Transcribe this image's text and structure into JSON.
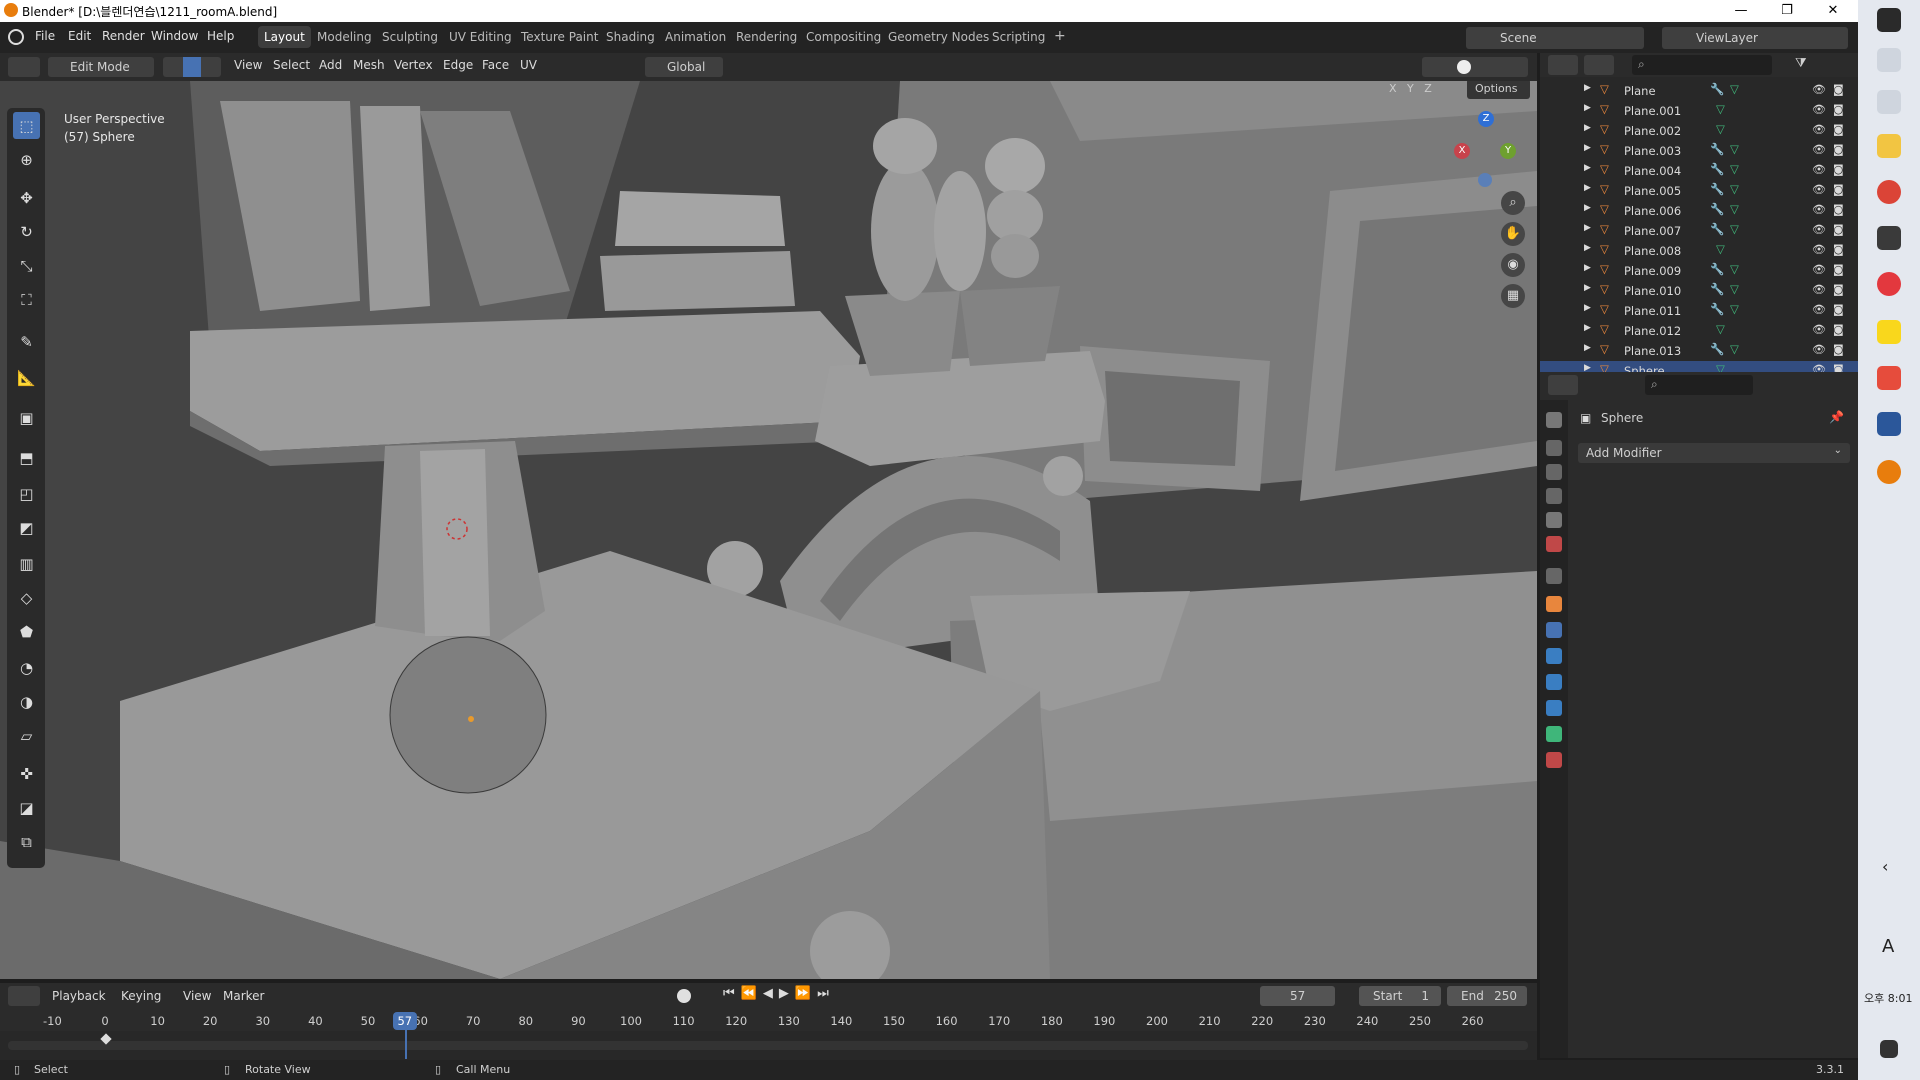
{
  "window": {
    "title": "Blender* [D:\\블렌더연습\\1211_roomA.blend]",
    "minimize": "—",
    "maximize": "❐",
    "close": "✕"
  },
  "menu": {
    "items": [
      "File",
      "Edit",
      "Render",
      "Window",
      "Help"
    ]
  },
  "workspaces": [
    "Layout",
    "Modeling",
    "Sculpting",
    "UV Editing",
    "Texture Paint",
    "Shading",
    "Animation",
    "Rendering",
    "Compositing",
    "Geometry Nodes",
    "Scripting",
    "+"
  ],
  "scene": {
    "name": "Scene",
    "view_layer": "ViewLayer"
  },
  "viewport_header": {
    "mode": "Edit Mode",
    "menus": [
      "View",
      "Select",
      "Add",
      "Mesh",
      "Vertex",
      "Edge",
      "Face",
      "UV"
    ],
    "transform": "Global",
    "options": "Options",
    "axes": [
      "X",
      "Y",
      "Z"
    ]
  },
  "viewport": {
    "perspective": "User Perspective",
    "object": "(57) Sphere"
  },
  "gizmo": {
    "z": "Z",
    "x": "X",
    "y": "Y"
  },
  "outliner": {
    "rows": [
      {
        "name": "Plane",
        "modifier": true
      },
      {
        "name": "Plane.001",
        "modifier": false
      },
      {
        "name": "Plane.002",
        "modifier": false
      },
      {
        "name": "Plane.003",
        "modifier": true
      },
      {
        "name": "Plane.004",
        "modifier": true
      },
      {
        "name": "Plane.005",
        "modifier": true
      },
      {
        "name": "Plane.006",
        "modifier": true
      },
      {
        "name": "Plane.007",
        "modifier": true
      },
      {
        "name": "Plane.008",
        "modifier": false
      },
      {
        "name": "Plane.009",
        "modifier": true
      },
      {
        "name": "Plane.010",
        "modifier": true
      },
      {
        "name": "Plane.011",
        "modifier": true
      },
      {
        "name": "Plane.012",
        "modifier": false
      },
      {
        "name": "Plane.013",
        "modifier": true
      },
      {
        "name": "Sphere",
        "modifier": false
      }
    ]
  },
  "properties": {
    "object": "Sphere",
    "add_modifier": "Add Modifier"
  },
  "timeline": {
    "menus": [
      "Playback",
      "Keying",
      "View",
      "Marker"
    ],
    "current_frame": "57",
    "start_label": "Start",
    "start": "1",
    "end_label": "End",
    "end": "250",
    "ticks": [
      "-10",
      "0",
      "10",
      "20",
      "30",
      "40",
      "50",
      "60",
      "70",
      "80",
      "90",
      "100",
      "110",
      "120",
      "130",
      "140",
      "150",
      "160",
      "170",
      "180",
      "190",
      "200",
      "210",
      "220",
      "230",
      "240",
      "250",
      "260"
    ]
  },
  "statusbar": {
    "left": "Select",
    "middle": "Rotate View",
    "right": "Call Menu",
    "version": "3.3.1"
  },
  "taskbar": {
    "time": "오후 8:01",
    "lang": "A"
  },
  "colors": {
    "accent": "#4772b3",
    "orange": "#e87d0d",
    "green": "#3fb67a"
  }
}
